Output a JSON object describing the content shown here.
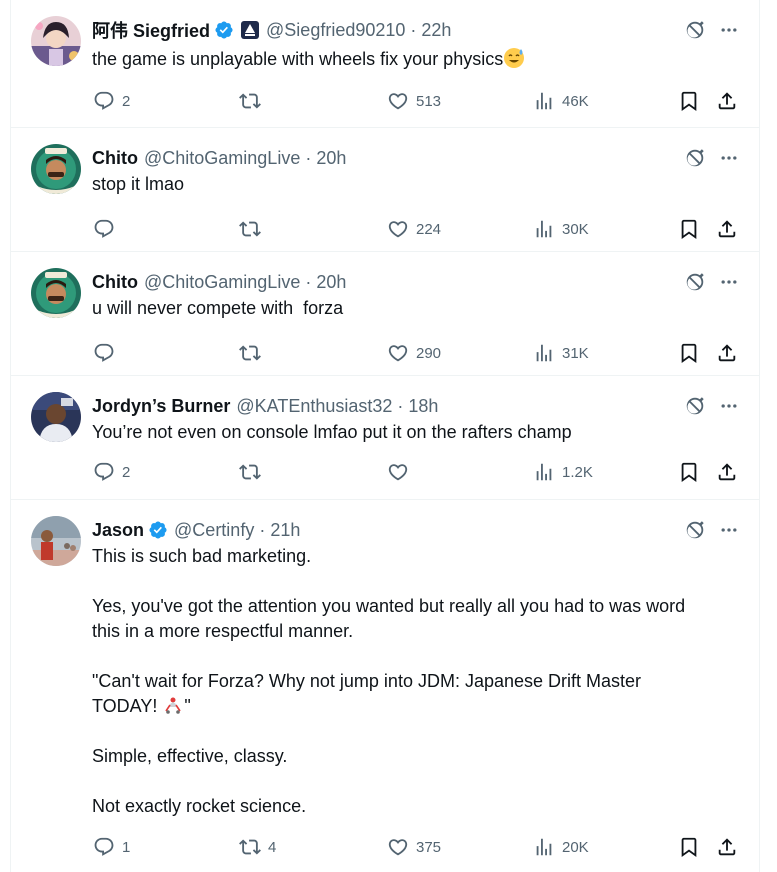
{
  "tweets": [
    {
      "name": "阿伟 Siegfried",
      "handle": "@Siegfried90210",
      "time": "22h",
      "verified": true,
      "affiliate": true,
      "text": [
        "the game is unplayable with wheels fix your physics"
      ],
      "emoji": "sweat-smile",
      "replies": "2",
      "reposts": "",
      "likes": "513",
      "views": "46K"
    },
    {
      "name": "Chito",
      "handle": "@ChitoGamingLive",
      "time": "20h",
      "text": [
        "stop it lmao"
      ],
      "replies": "",
      "reposts": "",
      "likes": "224",
      "views": "30K"
    },
    {
      "name": "Chito",
      "handle": "@ChitoGamingLive",
      "time": "20h",
      "text": [
        "u will never compete with  forza"
      ],
      "replies": "",
      "reposts": "",
      "likes": "290",
      "views": "31K"
    },
    {
      "name": "Jordyn’s Burner",
      "handle": "@KATEnthusiast32",
      "time": "18h",
      "text": [
        "You’re not even on console lmfao put it on the rafters champ"
      ],
      "replies": "2",
      "reposts": "",
      "likes": "",
      "views": "1.2K"
    },
    {
      "name": "Jason",
      "handle": "@Certinfy",
      "time": "21h",
      "verified": true,
      "text": [
        "This is such bad marketing.",
        "Yes, you've got the attention you wanted but really all you had to was word",
        "this in a more respectful manner.",
        "\"Can't wait for Forza? Why not jump into JDM: Japanese Drift Master",
        "TODAY! ",
        "Simple, effective, classy.",
        "Not exactly rocket science."
      ],
      "quote_close": "\"",
      "replies": "1",
      "reposts": "4",
      "likes": "375",
      "views": "20K"
    }
  ],
  "colors": {
    "text": "#0f1419",
    "secondary": "#536471",
    "verified": "#1d9bf0",
    "border": "#eff3f4"
  }
}
